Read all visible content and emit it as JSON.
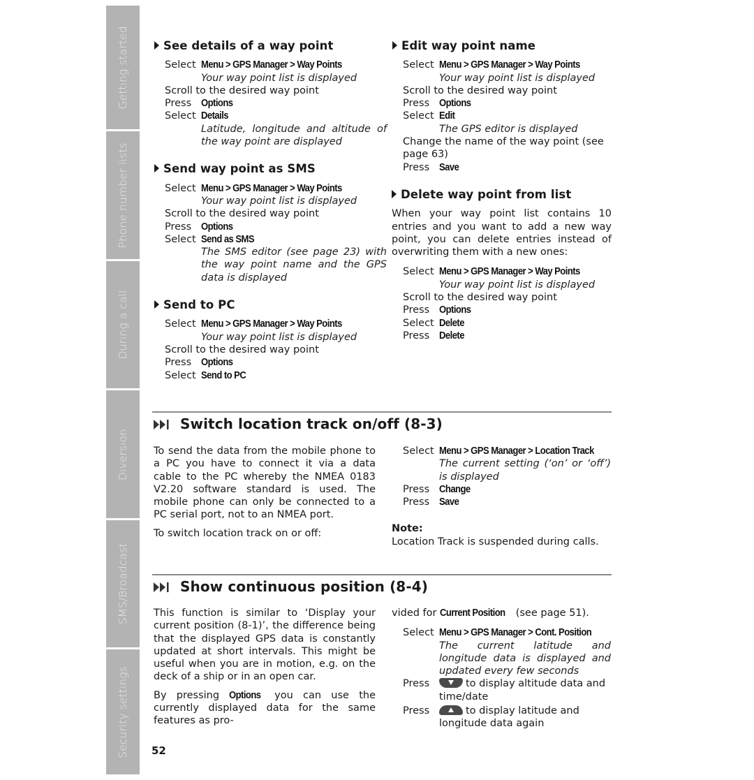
{
  "sidebar": {
    "tabs": [
      {
        "label": "Getting started"
      },
      {
        "label": "Phone number lists"
      },
      {
        "label": "During a call"
      },
      {
        "label": "Diversion"
      },
      {
        "label": "SMS/Broadcast"
      },
      {
        "label": "Security settings"
      }
    ]
  },
  "verbs": {
    "select": "Select",
    "press": "Press"
  },
  "waypoint_sections": {
    "details": {
      "title": "See details of a way point",
      "menu_path": "Menu > GPS Manager > Way Points",
      "result1": "Your way point list is displayed",
      "scroll": "Scroll to the desired way point",
      "options": "Options",
      "action": "Details",
      "result2": "Latitude, longitude and altitude of the way point are displayed"
    },
    "send_sms": {
      "title": "Send way point as SMS",
      "menu_path": "Menu > GPS Manager > Way Points",
      "result1": "Your way point list is displayed",
      "scroll": "Scroll to the desired way point",
      "options": "Options",
      "action": "Send as SMS",
      "result2": "The SMS editor (see page 23) with the way point name and the GPS data is displayed"
    },
    "send_pc": {
      "title": "Send to PC",
      "menu_path": "Menu > GPS Manager > Way Points",
      "result1": "Your way point list is displayed",
      "scroll": "Scroll to the desired way point",
      "options": "Options",
      "action": "Send to PC"
    },
    "edit": {
      "title": "Edit way point name",
      "menu_path": "Menu > GPS Manager > Way Points",
      "result1": "Your way point list is displayed",
      "scroll": "Scroll to the desired way point",
      "options": "Options",
      "action": "Edit",
      "result2": "The GPS editor is displayed",
      "change": "Change the name of the way point (see page 63)",
      "save": "Save"
    },
    "delete": {
      "title": "Delete way point from list",
      "intro": "When your way point list contains 10 entries and you want to add a new way point, you can delete entries instead of overwriting them with a new ones:",
      "menu_path": "Menu > GPS Manager > Way Points",
      "result1": "Your way point list is displayed",
      "scroll": "Scroll to the desired way point",
      "options": "Options",
      "action": "Delete",
      "confirm": "Delete"
    }
  },
  "location_track": {
    "title": "Switch location track on/off (8-3)",
    "para1": "To send the data from the mobile phone to a PC you have to connect it via a data cable to the PC whereby the NMEA 0183 V2.20 software standard is used. The mobile phone can only be connected to a PC serial port, not to an NMEA port.",
    "para2": "To switch location track on or off:",
    "menu_path": "Menu > GPS Manager > Location Track",
    "result": "The current setting (‘on’ or ‘off’) is displayed",
    "change": "Change",
    "save": "Save",
    "note_label": "Note:",
    "note_text": "Location Track is suspended during calls."
  },
  "continuous_position": {
    "title": "Show continuous position (8-4)",
    "para1": "This function is similar to ‘Display your current position (8-1)’, the difference being that the displayed GPS data is constantly updated at short intervals. This might be useful when you are in motion, e.g. on the deck of a ship or in an open car.",
    "para2_pre": "By pressing ",
    "para2_bold": "Options",
    "para2_post": " you can use the currently displayed data for the same features as pro-",
    "cont_pre": "vided for ",
    "cont_bold": "Current Position",
    "cont_post": " (see page 51).",
    "menu_path": "Menu > GPS Manager > Cont. Position",
    "result": "The current latitude and longitude data is displayed and updated every few seconds",
    "down_text": "to display altitude data and time/date",
    "up_text": "to display latitude and longitude data again"
  },
  "page_number": "52"
}
